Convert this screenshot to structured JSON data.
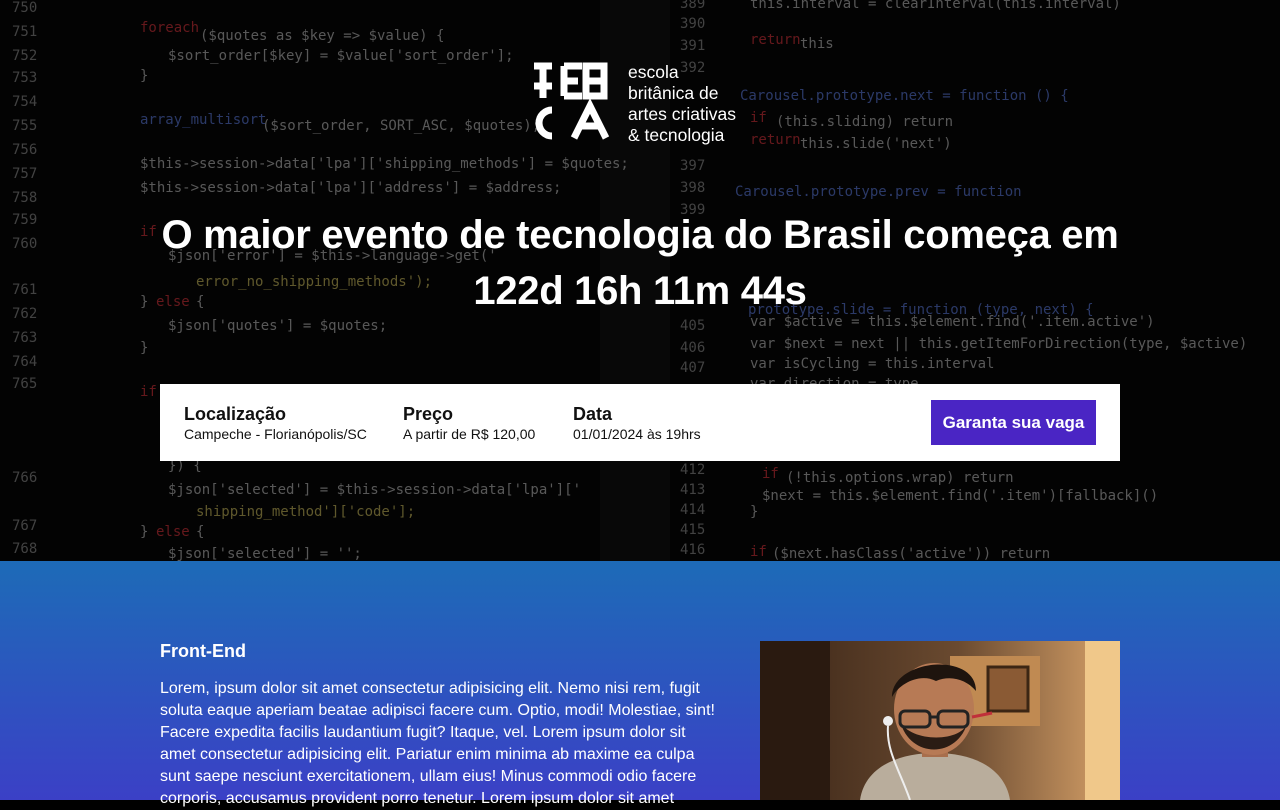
{
  "logo": {
    "lines": [
      "escola",
      "britânica de",
      "artes criativas",
      "& tecnologia"
    ]
  },
  "hero": {
    "headline_line1": "O maior evento de tecnologia do Brasil começa em",
    "countdown": "122d 16h 11m 44s"
  },
  "info": {
    "location_label": "Localização",
    "location_value": "Campeche - Florianópolis/SC",
    "price_label": "Preço",
    "price_value": "A partir de R$ 120,00",
    "date_label": "Data",
    "date_value": "01/01/2024 às 19hrs",
    "cta_label": "Garanta sua vaga"
  },
  "course": {
    "title": "Front-End",
    "description": "Lorem, ipsum dolor sit amet consectetur adipisicing elit. Nemo nisi rem, fugit soluta eaque aperiam beatae adipisci facere cum. Optio, modi! Molestiae, sint! Facere expedita facilis laudantium fugit? Itaque, vel. Lorem ipsum dolor sit amet consectetur adipisicing elit. Pariatur enim minima ab maxime ea culpa sunt saepe nesciunt exercitationem, ullam eius! Minus commodi odio facere corporis, accusamus provident porro tenetur. Lorem ipsum dolor sit amet"
  },
  "colors": {
    "cta": "#4a25c4",
    "section_top": "#1d6bb7",
    "section_bottom": "#3b40c6"
  },
  "icons": [
    "ebac-logo-icon",
    "person-laptop-photo"
  ]
}
